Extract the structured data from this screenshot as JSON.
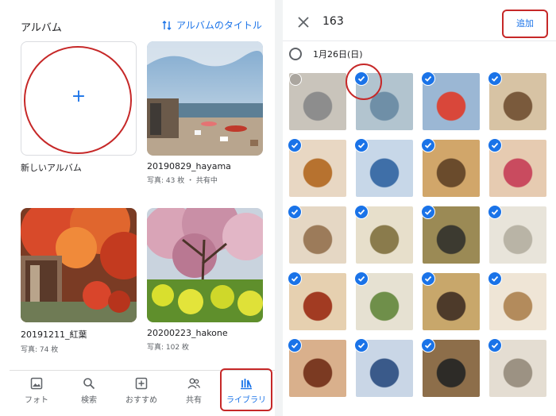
{
  "left": {
    "title": "アルバム",
    "title_action": "アルバムのタイトル",
    "new_album_label": "新しいアルバム",
    "albums": [
      {
        "name": "20190829_hayama",
        "meta": "写真: 43 枚 ・ 共有中"
      },
      {
        "name": "20191211_紅葉",
        "meta": "写真: 74 枚"
      },
      {
        "name": "20200223_hakone",
        "meta": "写真: 102 枚"
      }
    ],
    "nav": [
      {
        "label": "フォト",
        "icon": "photo-icon"
      },
      {
        "label": "検索",
        "icon": "search-icon"
      },
      {
        "label": "おすすめ",
        "icon": "plus-square-icon"
      },
      {
        "label": "共有",
        "icon": "people-icon"
      },
      {
        "label": "ライブラリ",
        "icon": "library-icon"
      }
    ]
  },
  "right": {
    "selected_count": "163",
    "add_label": "追加",
    "date_label": "1月26日(日)",
    "colors": {
      "accent": "#1a73e8",
      "highlight": "#c62828"
    }
  }
}
